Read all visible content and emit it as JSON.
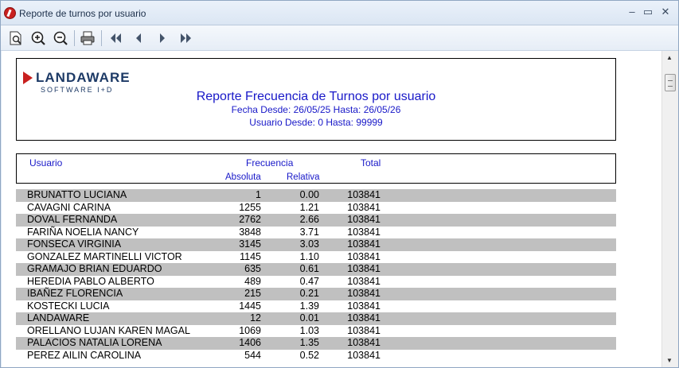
{
  "window": {
    "title": "Reporte de turnos por usuario",
    "controls": {
      "minimize": "–",
      "maximize": "▭",
      "close": "✕"
    }
  },
  "toolbar": {
    "icons": [
      "page-preview-icon",
      "zoom-in-icon",
      "zoom-out-icon",
      "print-icon",
      "first-page-icon",
      "previous-page-icon",
      "next-page-icon",
      "last-page-icon"
    ]
  },
  "report": {
    "logo_name": "LANDAWARE",
    "logo_sub": "SOFTWARE I+D",
    "title": "Reporte Frecuencia de Turnos por usuario",
    "fecha_line": "Fecha Desde: 26/05/25 Hasta: 26/05/26",
    "usuario_line": "Usuario Desde: 0 Hasta: 99999",
    "columns": {
      "usuario": "Usuario",
      "frecuencia": "Frecuencia",
      "total": "Total",
      "absoluta": "Absoluta",
      "relativa": "Relativa"
    },
    "rows": [
      {
        "name": "BRUNATTO LUCIANA",
        "abs": "1",
        "rel": "0.00",
        "total": "103841"
      },
      {
        "name": "CAVAGNI CARINA",
        "abs": "1255",
        "rel": "1.21",
        "total": "103841"
      },
      {
        "name": "DOVAL FERNANDA",
        "abs": "2762",
        "rel": "2.66",
        "total": "103841"
      },
      {
        "name": "FARIÑA NOELIA NANCY",
        "abs": "3848",
        "rel": "3.71",
        "total": "103841"
      },
      {
        "name": "FONSECA VIRGINIA",
        "abs": "3145",
        "rel": "3.03",
        "total": "103841"
      },
      {
        "name": "GONZALEZ MARTINELLI VICTOR",
        "abs": "1145",
        "rel": "1.10",
        "total": "103841"
      },
      {
        "name": "GRAMAJO BRIAN EDUARDO",
        "abs": "635",
        "rel": "0.61",
        "total": "103841"
      },
      {
        "name": "HEREDIA PABLO ALBERTO",
        "abs": "489",
        "rel": "0.47",
        "total": "103841"
      },
      {
        "name": "IBAÑEZ FLORENCIA",
        "abs": "215",
        "rel": "0.21",
        "total": "103841"
      },
      {
        "name": "KOSTECKI LUCIA",
        "abs": "1445",
        "rel": "1.39",
        "total": "103841"
      },
      {
        "name": "LANDAWARE",
        "abs": "12",
        "rel": "0.01",
        "total": "103841"
      },
      {
        "name": "ORELLANO LUJAN KAREN MAGAL",
        "abs": "1069",
        "rel": "1.03",
        "total": "103841"
      },
      {
        "name": "PALACIOS NATALIA LORENA",
        "abs": "1406",
        "rel": "1.35",
        "total": "103841"
      },
      {
        "name": "PEREZ AILIN CAROLINA",
        "abs": "544",
        "rel": "0.52",
        "total": "103841"
      }
    ]
  },
  "scrollbar": {
    "up": "▲",
    "down": "▼"
  }
}
